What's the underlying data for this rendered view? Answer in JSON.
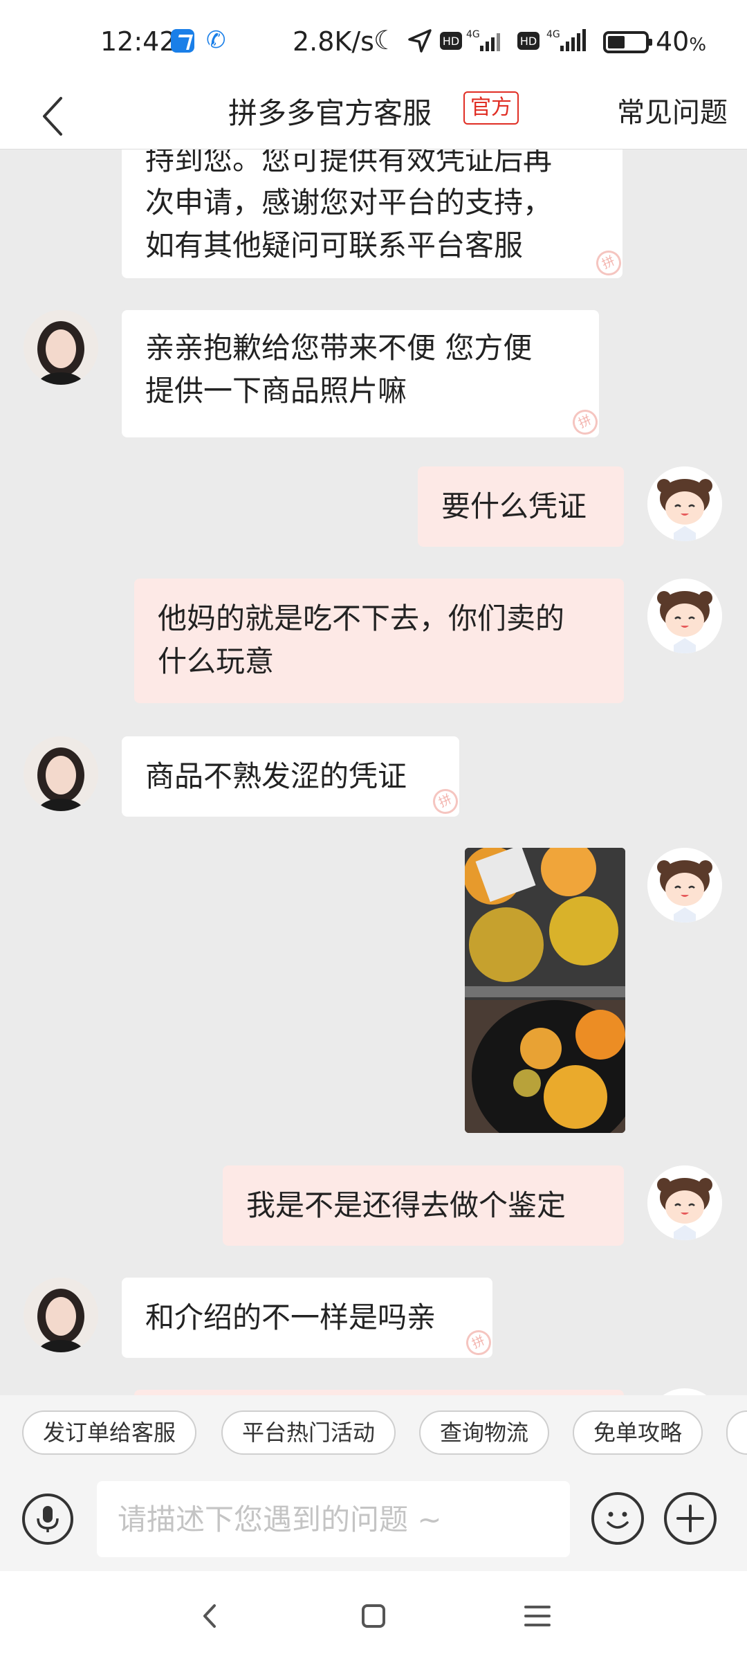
{
  "status_bar": {
    "time": "12:42",
    "network_speed": "2.8K/s",
    "net_type_1": "4G",
    "net_type_2": "4G",
    "hd_1": "HD",
    "hd_2": "HD",
    "battery_percent": "40",
    "battery_unit": "%"
  },
  "header": {
    "title": "拼多多官方客服",
    "tag": "官方",
    "faq": "常见问题"
  },
  "messages": [
    {
      "from": "agent",
      "lines": [
        "持到您。您可提供有效凭证后再",
        "次申请，感谢您对平台的支持，",
        "如有其他疑问可联系平台客服"
      ]
    },
    {
      "from": "agent",
      "lines": [
        "亲亲抱歉给您带来不便 您方便",
        "提供一下商品照片嘛"
      ]
    },
    {
      "from": "user",
      "lines": [
        "要什么凭证"
      ]
    },
    {
      "from": "user",
      "lines": [
        "他妈的就是吃不下去，你们卖的",
        "什么玩意"
      ]
    },
    {
      "from": "agent",
      "lines": [
        "商品不熟发涩的凭证"
      ]
    },
    {
      "from": "user",
      "type": "image",
      "description": "photo"
    },
    {
      "from": "user",
      "lines": [
        "我是不是还得去做个鉴定"
      ]
    },
    {
      "from": "agent",
      "lines": [
        "和介绍的不一样是吗亲"
      ]
    }
  ],
  "watermark": "拼",
  "quick_replies": [
    "发订单给客服",
    "平台热门活动",
    "查询物流",
    "免单攻略"
  ],
  "input": {
    "placeholder": "请描述下您遇到的问题 ~"
  },
  "colors": {
    "brand_red": "#e02e24",
    "user_bubble": "#fde9e6",
    "agent_bubble": "#ffffff",
    "chat_bg": "#ebebeb"
  },
  "icons": {
    "back": "chevron-left-icon",
    "mic": "mic-icon",
    "emoji": "smiley-icon",
    "plus": "plus-icon",
    "nav_back": "nav-back-icon",
    "nav_home": "nav-home-icon",
    "nav_menu": "nav-menu-icon"
  }
}
